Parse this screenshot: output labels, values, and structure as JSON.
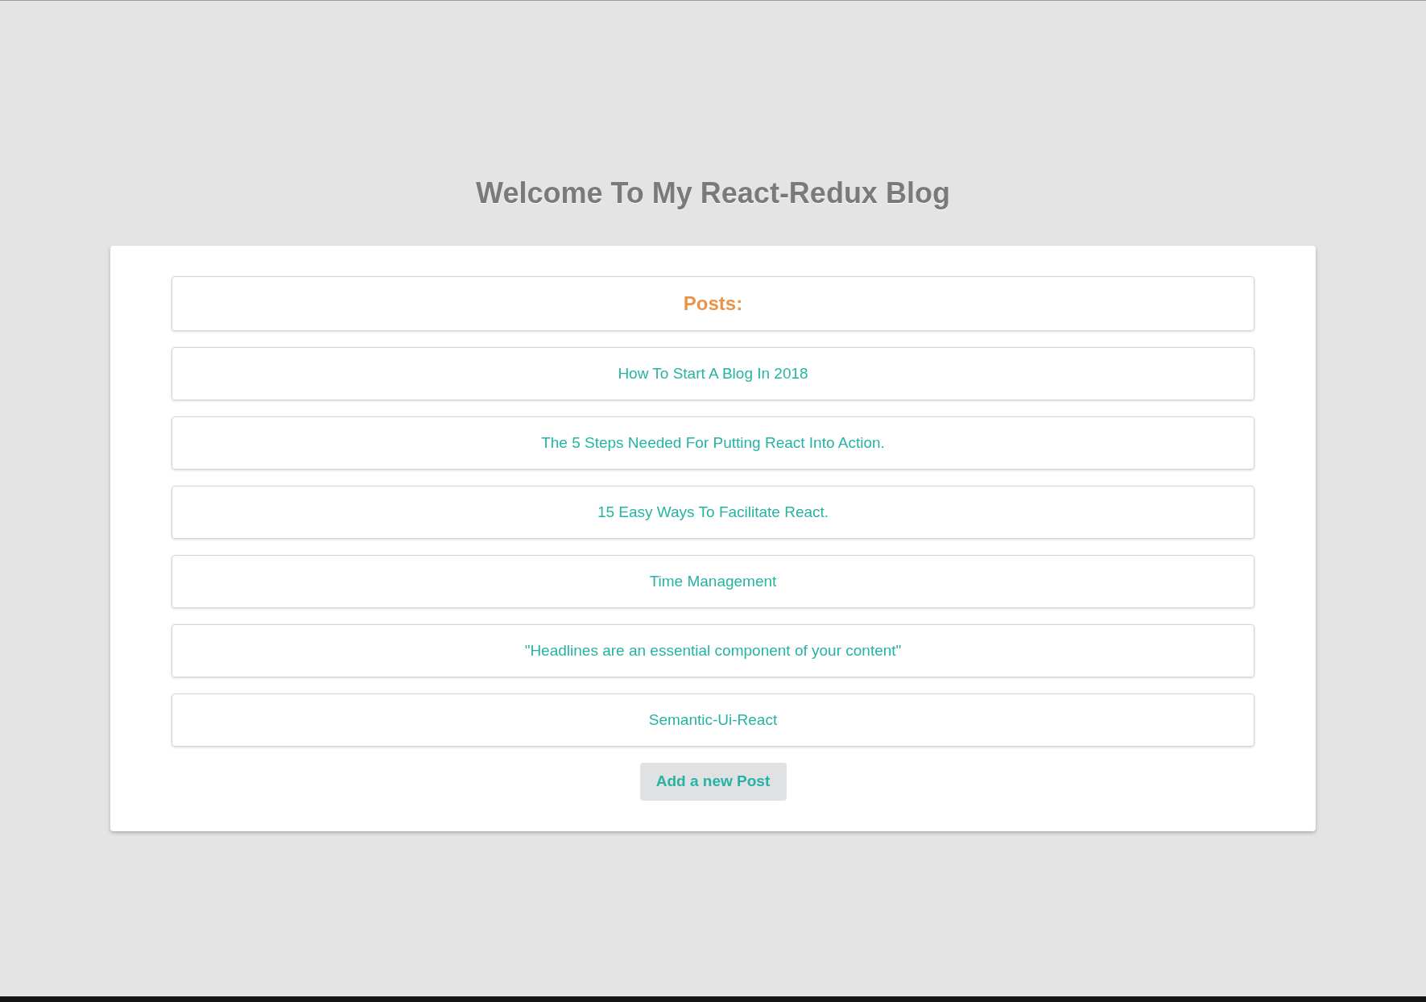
{
  "title": "Welcome To My React-Redux Blog",
  "posts_header": "Posts:",
  "posts": [
    {
      "title": "How To Start A Blog In 2018"
    },
    {
      "title": "The 5 Steps Needed For Putting React Into Action."
    },
    {
      "title": "15 Easy Ways To Facilitate React."
    },
    {
      "title": "Time Management"
    },
    {
      "title": "\"Headlines are an essential component of your content\""
    },
    {
      "title": "Semantic-Ui-React"
    }
  ],
  "add_button": "Add a new Post"
}
